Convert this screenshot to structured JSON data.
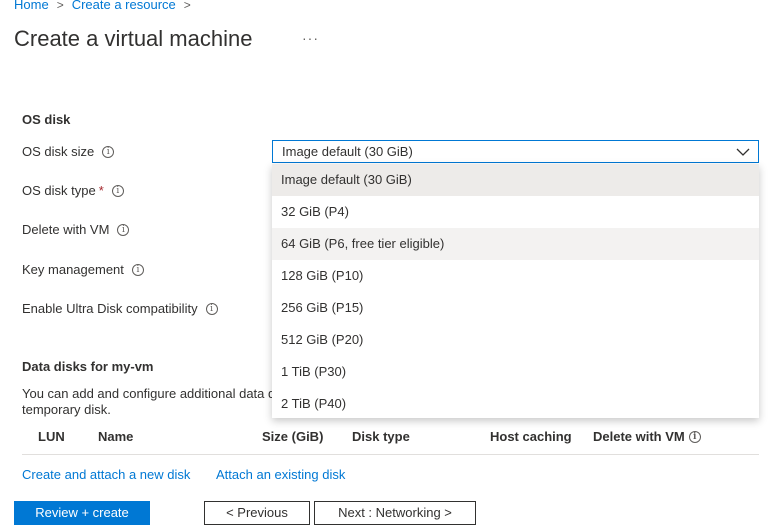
{
  "breadcrumb": {
    "home": "Home",
    "create": "Create a resource",
    "sep": ">"
  },
  "page": {
    "title": "Create a virtual machine",
    "more": "···"
  },
  "os_disk": {
    "heading": "OS disk",
    "size_label": "OS disk size",
    "type_label": "OS disk type",
    "required_mark": "*",
    "delete_label": "Delete with VM",
    "key_label": "Key management",
    "ultra_label": "Enable Ultra Disk compatibility",
    "selected_value": "Image default (30 GiB)",
    "options": [
      "Image default (30 GiB)",
      "32 GiB (P4)",
      "64 GiB (P6, free tier eligible)",
      "128 GiB (P10)",
      "256 GiB (P15)",
      "512 GiB (P20)",
      "1 TiB (P30)",
      "2 TiB (P40)"
    ]
  },
  "data_disks": {
    "heading": "Data disks for my-vm",
    "desc_line1": "You can add and configure additional data d",
    "desc_line2": "temporary disk.",
    "columns": [
      "LUN",
      "Name",
      "Size (GiB)",
      "Disk type",
      "Host caching",
      "Delete with VM"
    ],
    "create_link": "Create and attach a new disk",
    "attach_link": "Attach an existing disk"
  },
  "footer": {
    "review": "Review + create",
    "previous": "< Previous",
    "next": "Next : Networking >"
  },
  "colors": {
    "accent": "#0078d4",
    "required": "#a4262c"
  }
}
